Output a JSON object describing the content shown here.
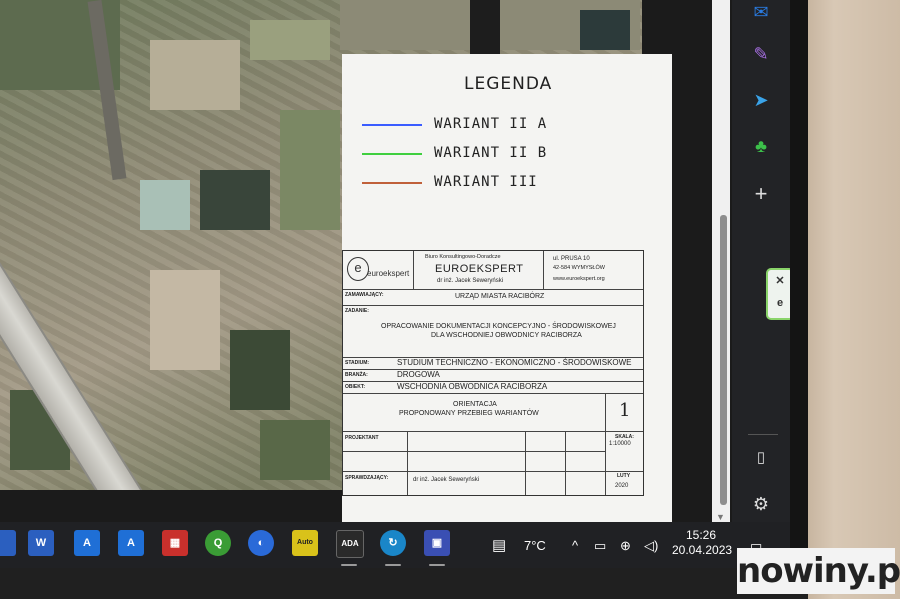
{
  "legend": {
    "title": "LEGENDA",
    "items": [
      {
        "label": "WARIANT II A",
        "color": "#3a5cff"
      },
      {
        "label": "WARIANT II B",
        "color": "#3fcf3f"
      },
      {
        "label": "WARIANT III",
        "color": "#c0603a"
      }
    ]
  },
  "title_block": {
    "logo_text": "euroekspert",
    "company_top": "Biuro Konsultingowo-Doradcze",
    "company_name": "EUROEKSPERT",
    "company_person": "dr inż. Jacek Seweryński",
    "address_street": "ul. PRUSA 10",
    "address_city": "42-584 WYMYSŁÓW",
    "address_web": "www.euroekspert.org",
    "zamawiajacy_label": "ZAMAWIAJĄCY:",
    "zamawiajacy_value": "URZĄD MIASTA RACIBÓRZ",
    "zadanie_label": "ZADANIE:",
    "zadanie_line1": "OPRACOWANIE DOKUMENTACJI KONCEPCYJNO - ŚRODOWISKOWEJ",
    "zadanie_line2": "DLA WSCHODNIEJ OBWODNICY RACIBORZA",
    "stadium_label": "STADIUM:",
    "stadium_value": "STUDIUM TECHNICZNO - EKONOMICZNO - ŚRODOWISKOWE",
    "branza_label": "BRANŻA:",
    "branza_value": "DROGOWA",
    "obiekt_label": "OBIEKT:",
    "obiekt_value": "WSCHODNIA OBWODNICA RACIBORZA",
    "drawing_line1": "ORIENTACJA",
    "drawing_line2": "PROPONOWANY PRZEBIEG WARIANTÓW",
    "drawing_number": "1",
    "projektant_label": "PROJEKTANT",
    "skala_label": "SKALA:",
    "skala_value": "1:10000",
    "sprawdzajacy_label": "SPRAWDZAJĄCY:",
    "sprawdzajacy_value": "dr inż. Jacek Seweryński",
    "date_month": "LUTY",
    "date_year": "2020"
  },
  "taskbar": {
    "apps": [
      {
        "name": "word",
        "glyph": "W",
        "color": "#2b5fbf"
      },
      {
        "name": "autocad-a",
        "glyph": "A",
        "color": "#1f6fd6"
      },
      {
        "name": "autocad-b",
        "glyph": "A",
        "color": "#1f6fd6"
      },
      {
        "name": "app-red",
        "glyph": "▦",
        "color": "#c9302c"
      },
      {
        "name": "qgis",
        "glyph": "Q",
        "color": "#3a9c35"
      },
      {
        "name": "app-blue",
        "glyph": "◐",
        "color": "#2a6ad8"
      },
      {
        "name": "autoroutes",
        "glyph": "Auto",
        "color": "#d9c21a"
      },
      {
        "name": "ada",
        "glyph": "ADA",
        "color": "#2a2a2a"
      },
      {
        "name": "app-circle",
        "glyph": "↻",
        "color": "#1a86c8"
      },
      {
        "name": "app-map",
        "glyph": "▣",
        "color": "#3a4fb3"
      }
    ],
    "weather": "7°C",
    "time": "15:26",
    "date": "20.04.2023"
  },
  "sidebar_icons": [
    "outlook-icon",
    "editor-icon",
    "telegram-icon",
    "tree-icon",
    "add-icon",
    "split-view-icon",
    "settings-icon"
  ],
  "watermark": "nowiny.pl"
}
